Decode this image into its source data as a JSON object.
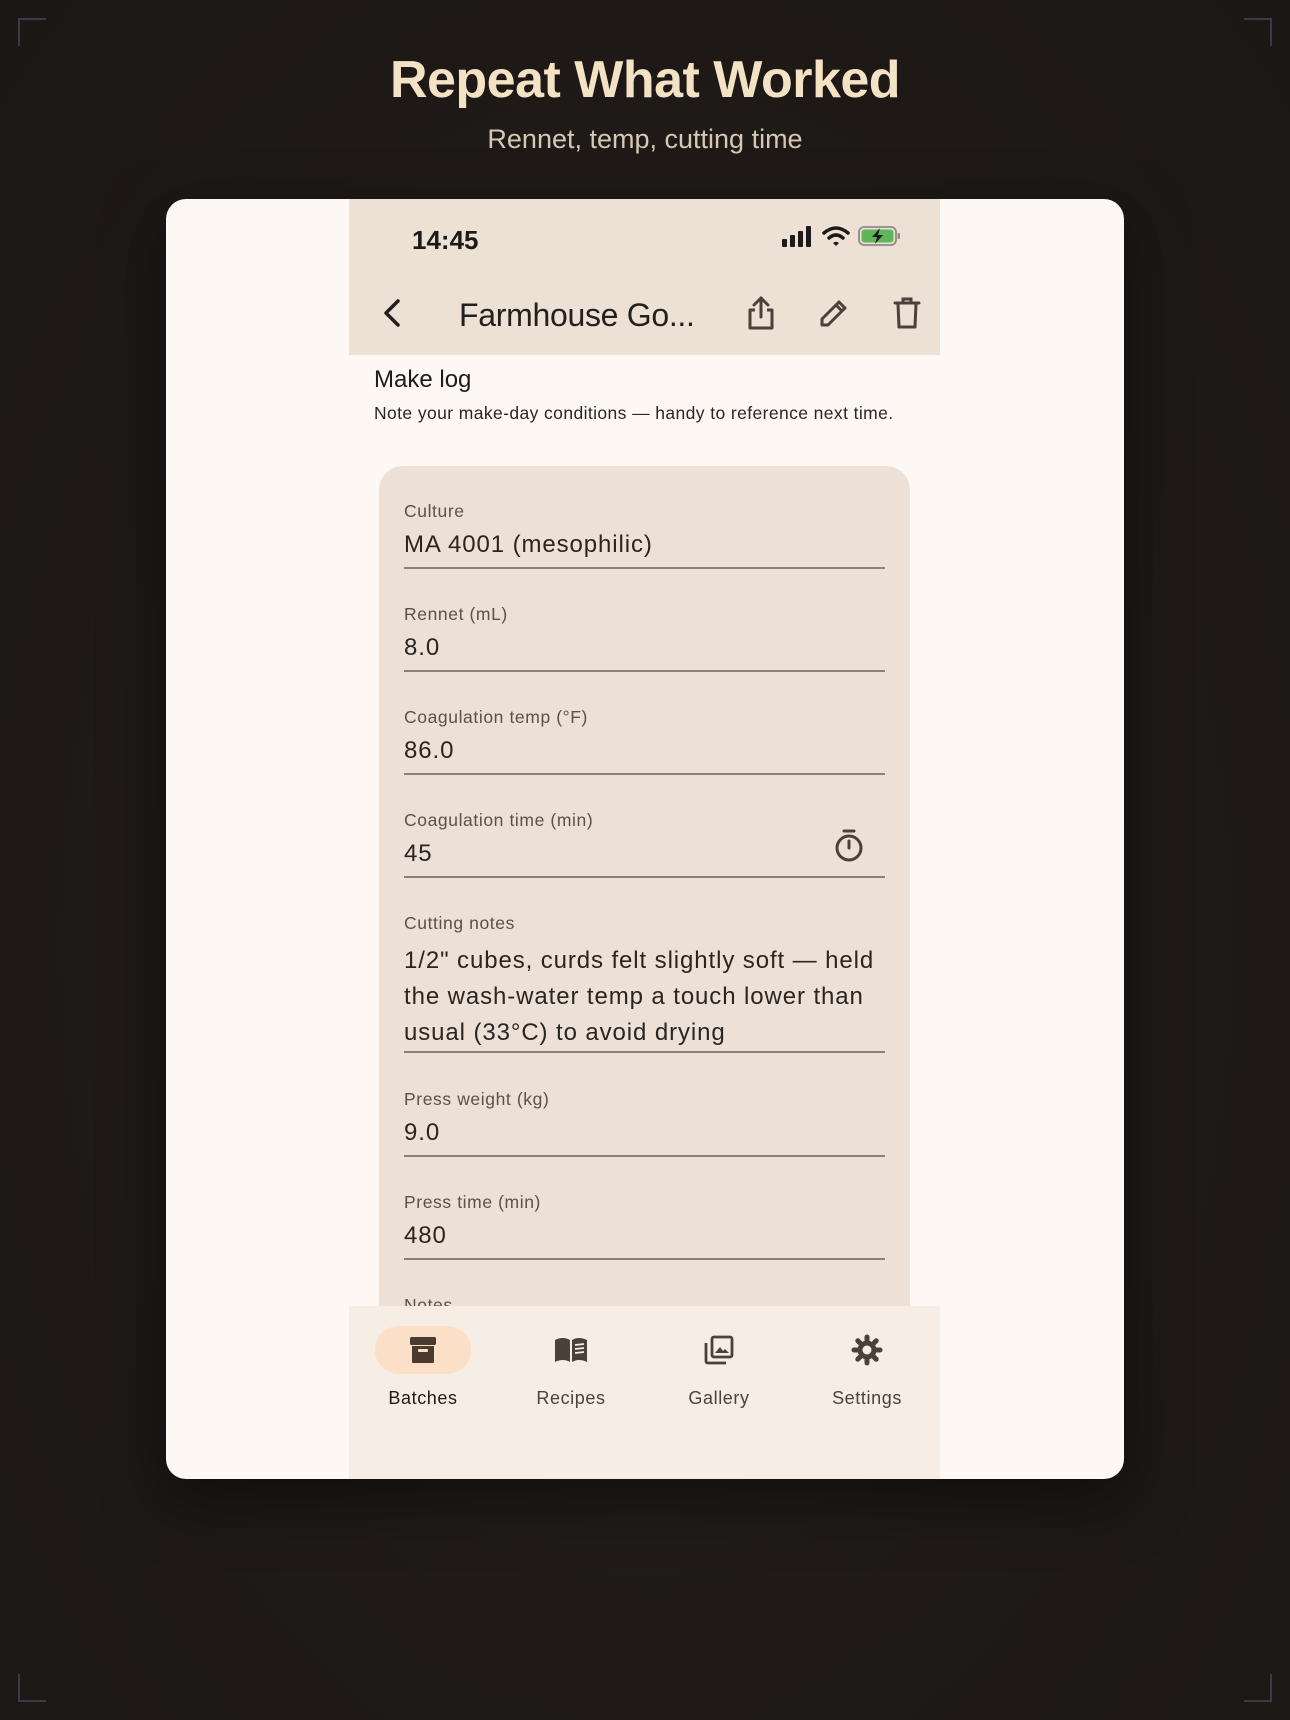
{
  "promo": {
    "headline": "Repeat What Worked",
    "subhead": "Rennet, temp, cutting time"
  },
  "status_bar": {
    "time": "14:45",
    "icons": [
      "signal-icon",
      "wifi-icon",
      "battery-charging-icon"
    ],
    "battery_color": "#5fb55a"
  },
  "app_bar": {
    "title": "Farmhouse Go...",
    "actions": [
      "share-icon",
      "edit-icon",
      "delete-icon"
    ]
  },
  "section": {
    "title": "Make log",
    "description": "Note your make-day conditions — handy to reference next time."
  },
  "fields": [
    {
      "label": "Culture",
      "value": "MA 4001 (mesophilic)"
    },
    {
      "label": "Rennet (mL)",
      "value": "8.0"
    },
    {
      "label": "Coagulation temp (°F)",
      "value": "86.0"
    },
    {
      "label": "Coagulation time (min)",
      "value": "45",
      "trailing_icon": "timer-icon"
    },
    {
      "label": "Cutting notes",
      "value": "1/2\" cubes, curds felt slightly soft — held the wash-water temp a touch lower than usual (33°C) to avoid drying"
    },
    {
      "label": "Press weight (kg)",
      "value": "9.0"
    },
    {
      "label": "Press time (min)",
      "value": "480"
    },
    {
      "label": "Notes",
      "value": ""
    }
  ],
  "nav": [
    {
      "label": "Batches",
      "icon": "archive-box-icon",
      "active": true
    },
    {
      "label": "Recipes",
      "icon": "book-icon",
      "active": false
    },
    {
      "label": "Gallery",
      "icon": "photo-library-icon",
      "active": false
    },
    {
      "label": "Settings",
      "icon": "gear-icon",
      "active": false
    }
  ],
  "colors": {
    "background": "#1f1a18",
    "headline": "#f3e3c4",
    "surface": "#ede0d5",
    "card": "#ede0d7",
    "nav_active_pill": "#fbdfc6"
  }
}
